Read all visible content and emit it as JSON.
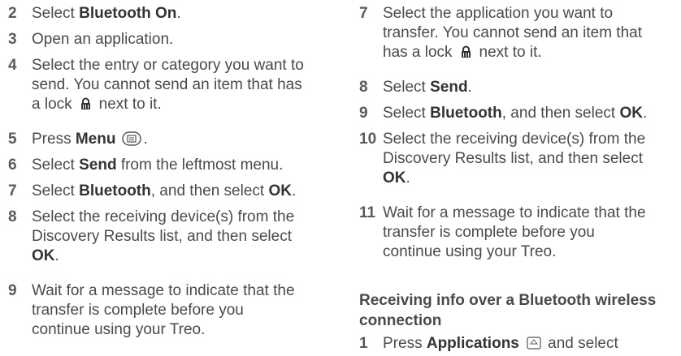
{
  "icons": {
    "lock": "lock-icon",
    "menu": "menu-key-icon",
    "applications": "applications-key-icon"
  },
  "left": {
    "s2": {
      "num": "2",
      "pre": "Select ",
      "bold": "Bluetooth On",
      "post": "."
    },
    "s3": {
      "num": "3",
      "text": "Open an application."
    },
    "s4": {
      "num": "4",
      "line1": "Select the entry or category you want to",
      "line2": "send. You cannot send an item that has",
      "line3a": "a lock",
      "line3b": "next to it."
    },
    "s5": {
      "num": "5",
      "pre": "Press ",
      "bold": "Menu",
      "post": "."
    },
    "s6": {
      "num": "6",
      "pre": "Select ",
      "bold": "Send",
      "post": " from the leftmost menu."
    },
    "s7": {
      "num": "7",
      "pre": "Select ",
      "bold1": "Bluetooth",
      "mid": ", and then select ",
      "bold2": "OK",
      "post": "."
    },
    "s8": {
      "num": "8",
      "line1": "Select the receiving device(s) from the",
      "line2": "Discovery Results list, and then select",
      "bold": "OK",
      "post": "."
    },
    "s9": {
      "num": "9",
      "line1": "Wait for a message to indicate that the",
      "line2": "transfer is complete before you",
      "line3": "continue using your Treo."
    }
  },
  "right": {
    "s7": {
      "num": "7",
      "line1": "Select the application you want to",
      "line2": "transfer. You cannot send an item that",
      "line3a": "has a lock",
      "line3b": "next to it."
    },
    "s8": {
      "num": "8",
      "pre": "Select ",
      "bold": "Send",
      "post": "."
    },
    "s9": {
      "num": "9",
      "pre": "Select ",
      "bold1": "Bluetooth",
      "mid": ", and then select ",
      "bold2": "OK",
      "post": "."
    },
    "s10": {
      "num": "10",
      "line1": "Select the receiving device(s) from the",
      "line2": "Discovery Results list, and then select",
      "bold": "OK",
      "post": "."
    },
    "s11": {
      "num": "11",
      "line1": "Wait for a message to indicate that the",
      "line2": "transfer is complete before you",
      "line3": "continue using your Treo."
    },
    "heading": {
      "line1": "Receiving info over a Bluetooth wireless",
      "line2": "connection"
    },
    "s1": {
      "num": "1",
      "pre": "Press ",
      "bold": "Applications",
      "post": " and select"
    }
  }
}
